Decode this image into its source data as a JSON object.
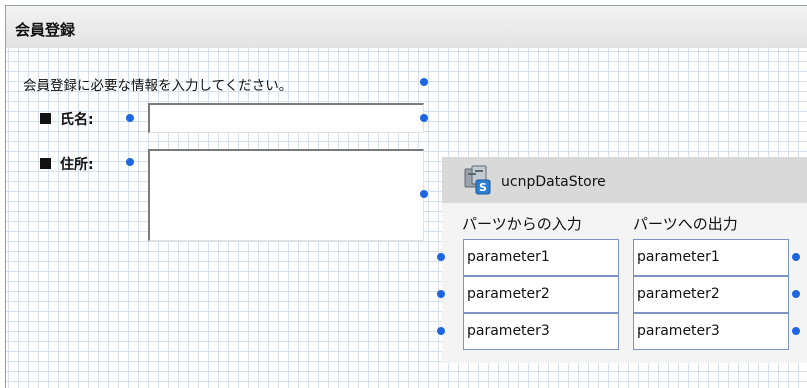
{
  "window": {
    "title": "会員登録"
  },
  "form": {
    "intro": "会員登録に必要な情報を入力してください。",
    "name_label": "氏名:",
    "name_value": "",
    "address_label": "住所:",
    "address_value": ""
  },
  "datastore": {
    "name": "ucnpDataStore",
    "icon": "datastore-icon",
    "input_header": "パーツからの入力",
    "output_header": "パーツへの出力",
    "inputs": [
      "parameter1",
      "parameter2",
      "parameter3"
    ],
    "outputs": [
      "parameter1",
      "parameter2",
      "parameter3"
    ]
  },
  "colors": {
    "connector_dot": "#1d66e0",
    "grid_line": "#d5e2ee",
    "param_border": "#7c94c4"
  }
}
